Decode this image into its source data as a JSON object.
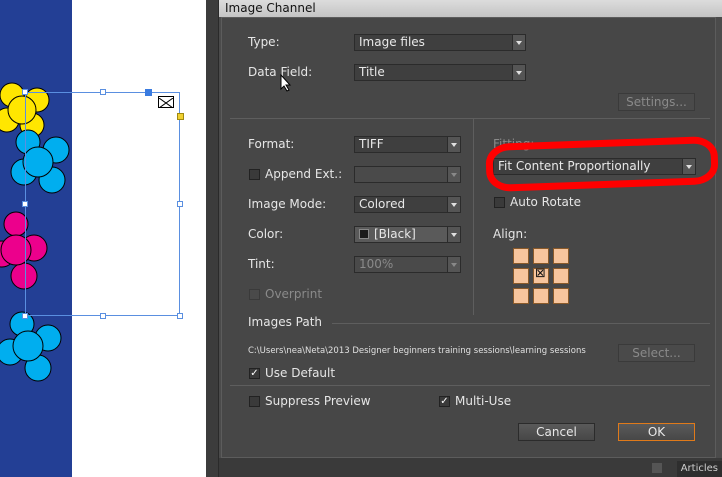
{
  "dialog": {
    "title": "Image Channel",
    "type_label": "Type:",
    "type_value": "Image files",
    "data_field_label": "Data Field:",
    "data_field_value": "Title",
    "settings_button": "Settings...",
    "format_label": "Format:",
    "format_value": "TIFF",
    "append_ext_label": "Append Ext.:",
    "append_ext_value": "",
    "image_mode_label": "Image Mode:",
    "image_mode_value": "Colored",
    "color_label": "Color:",
    "color_value": "[Black]",
    "tint_label": "Tint:",
    "tint_value": "100%",
    "overprint_label": "Overprint",
    "fitting_label": "Fitting:",
    "fitting_value": "Fit Content Proportionally",
    "auto_rotate_label": "Auto Rotate",
    "align_label": "Align:",
    "images_path_label": "Images Path",
    "images_path_value": "C:\\Users\\nea\\Neta\\2013 Designer beginners training sessions\\learning sessions",
    "select_button": "Select...",
    "use_default_label": "Use Default",
    "suppress_preview_label": "Suppress Preview",
    "multi_use_label": "Multi-Use",
    "cancel_button": "Cancel",
    "ok_button": "OK"
  },
  "checkboxes": {
    "append_ext": false,
    "overprint": false,
    "auto_rotate": false,
    "use_default": true,
    "suppress_preview": false,
    "multi_use": true
  },
  "align": {
    "selected": "center"
  },
  "background": {
    "articles_tab": "Articles"
  },
  "colors": {
    "dialog_bg": "#474747",
    "highlight": "#ff0000",
    "align_cell": "#f7c59d",
    "ok_border": "#e07a1a",
    "blue_strip": "#233f95",
    "flower_yellow": "#ffe600",
    "flower_cyan": "#00aeef",
    "flower_magenta": "#ec008c"
  }
}
